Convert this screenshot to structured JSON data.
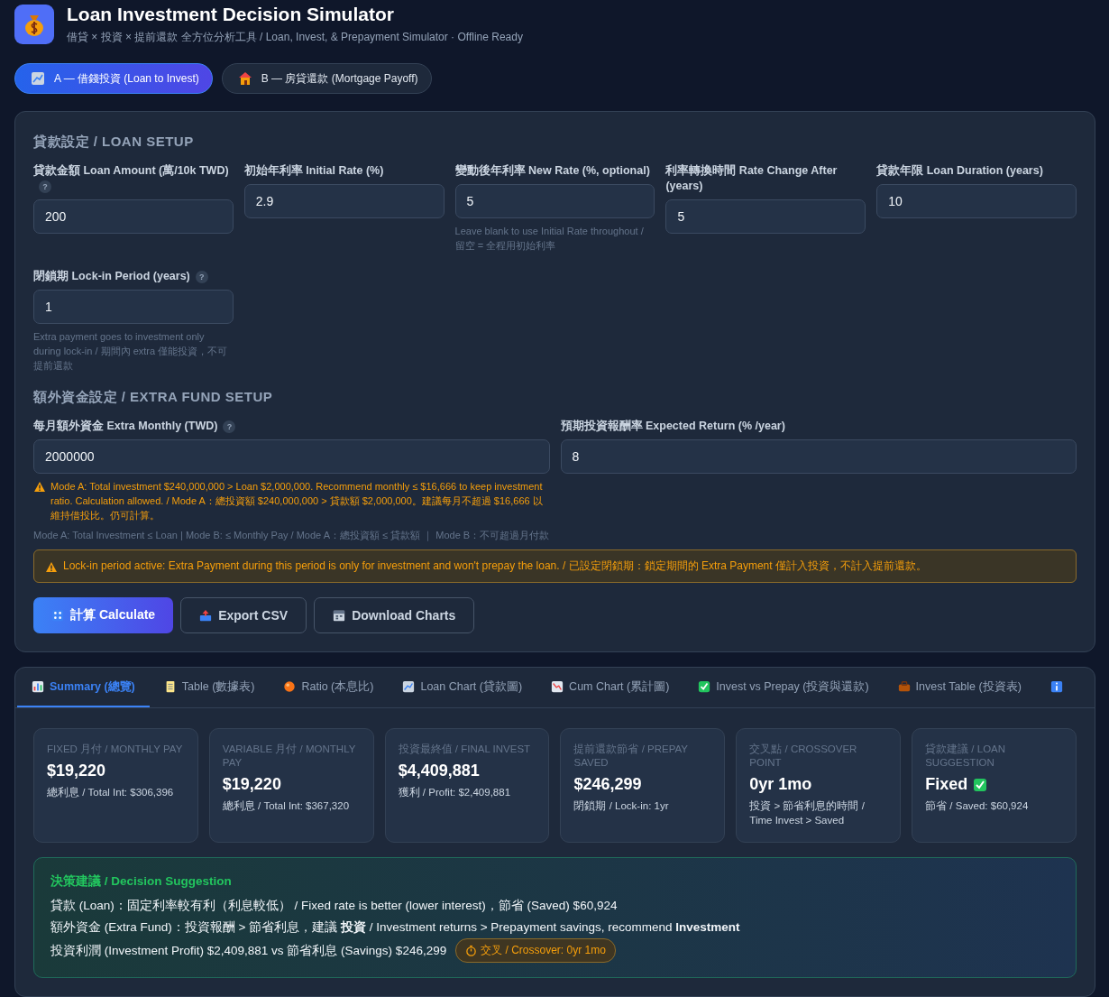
{
  "header": {
    "title": "Loan Investment Decision Simulator",
    "subtitle": "借貸 × 投資 × 提前還款 全方位分析工具 / Loan, Invest, & Prepayment Simulator · Offline Ready"
  },
  "modes": [
    {
      "label": "A — 借錢投資 (Loan to Invest)",
      "selected": true
    },
    {
      "label": "B — 房貸還款 (Mortgage Payoff)",
      "selected": false
    }
  ],
  "loan_setup": {
    "heading": "貸款設定 / LOAN SETUP",
    "fields": [
      {
        "label": "貸款金額 Loan Amount (萬/10k TWD)",
        "help": "?",
        "value": "200"
      },
      {
        "label": "初始年利率 Initial Rate (%)",
        "value": "2.9"
      },
      {
        "label": "變動後年利率 New Rate (%, optional)",
        "value": "5",
        "hint": "Leave blank to use Initial Rate throughout / 留空 = 全程用初始利率"
      },
      {
        "label": "利率轉換時間 Rate Change After (years)",
        "value": "5"
      },
      {
        "label": "貸款年限 Loan Duration (years)",
        "value": "10"
      },
      {
        "label": "閉鎖期 Lock-in Period (years)",
        "help": "?",
        "value": "1",
        "hint": "Extra payment goes to investment only during lock-in / 期間內 extra 僅能投資，不可提前還款"
      }
    ]
  },
  "extra_setup": {
    "heading": "額外資金設定 / EXTRA FUND SETUP",
    "fields": [
      {
        "label": "每月額外資金 Extra Monthly (TWD)",
        "help": "?",
        "value": "2000000",
        "warning": "Mode A: Total investment $240,000,000 > Loan $2,000,000. Recommend monthly ≤ $16,666 to keep investment ratio. Calculation allowed. / Mode A：總投資額 $240,000,000 > 貸款額 $2,000,000。建議每月不超過 $16,666 以維持借投比。仍可計算。",
        "hint": "Mode A: Total Investment ≤ Loan | Mode B: ≤ Monthly Pay / Mode A：總投資額 ≤ 貸款額 ｜ Mode B：不可超過月付款"
      },
      {
        "label": "預期投資報酬率 Expected Return (% /year)",
        "value": "8"
      }
    ],
    "banner": "Lock-in period active: Extra Payment during this period is only for investment and won't prepay the loan. / 已設定閉鎖期：鎖定期間的 Extra Payment 僅計入投資，不計入提前還款。"
  },
  "actions": [
    {
      "kind": "primary",
      "label": "計算 Calculate"
    },
    {
      "kind": "secondary",
      "label": "Export CSV"
    },
    {
      "kind": "secondary",
      "label": "Download Charts"
    }
  ],
  "result_tabs": [
    {
      "label": "Summary (總覽)",
      "selected": true
    },
    {
      "label": "Table (數據表)",
      "selected": false
    },
    {
      "label": "Ratio (本息比)",
      "selected": false
    },
    {
      "label": "Loan Chart (貸款圖)",
      "selected": false
    },
    {
      "label": "Cum Chart (累計圖)",
      "selected": false
    },
    {
      "label": "Invest vs Prepay (投資與還款)",
      "selected": false
    },
    {
      "label": "Invest Table (投資表)",
      "selected": false
    },
    {
      "selected": false
    }
  ],
  "summary_cards": [
    {
      "label": "FIXED 月付 / MONTHLY PAY",
      "value": "$19,220",
      "sub": "總利息 / Total Int: $306,396"
    },
    {
      "label": "VARIABLE 月付 / MONTHLY PAY",
      "value": "$19,220",
      "sub": "總利息 / Total Int: $367,320"
    },
    {
      "label": "投資最終值 / FINAL INVEST",
      "value": "$4,409,881",
      "sub": "獲利 / Profit: $2,409,881"
    },
    {
      "label": "提前還款節省 / PREPAY SAVED",
      "value": "$246,299",
      "sub": "閉鎖期 / Lock-in: 1yr"
    },
    {
      "label": "交叉點 / CROSSOVER POINT",
      "value": "0yr 1mo",
      "sub": "投資 > 節省利息的時間 / Time Invest > Saved"
    },
    {
      "label": "貸款建議 / LOAN SUGGESTION",
      "value": "Fixed",
      "verified": true,
      "sub": "節省 / Saved: $60,924"
    }
  ],
  "decision": {
    "title": "決策建議 / Decision Suggestion",
    "lines": [
      "貸款 (Loan)：固定利率較有利（利息較低） / Fixed rate is better (lower interest)，節省 (Saved) $60,924",
      "額外資金 (Extra Fund)：投資報酬 > 節省利息，建議 **投資** / Investment returns > Prepayment savings, recommend **Investment**",
      "投資利潤 (Investment Profit) $2,409,881 vs 節省利息 (Savings) $246,299"
    ],
    "badge": "交叉 / Crossover: 0yr 1mo"
  }
}
